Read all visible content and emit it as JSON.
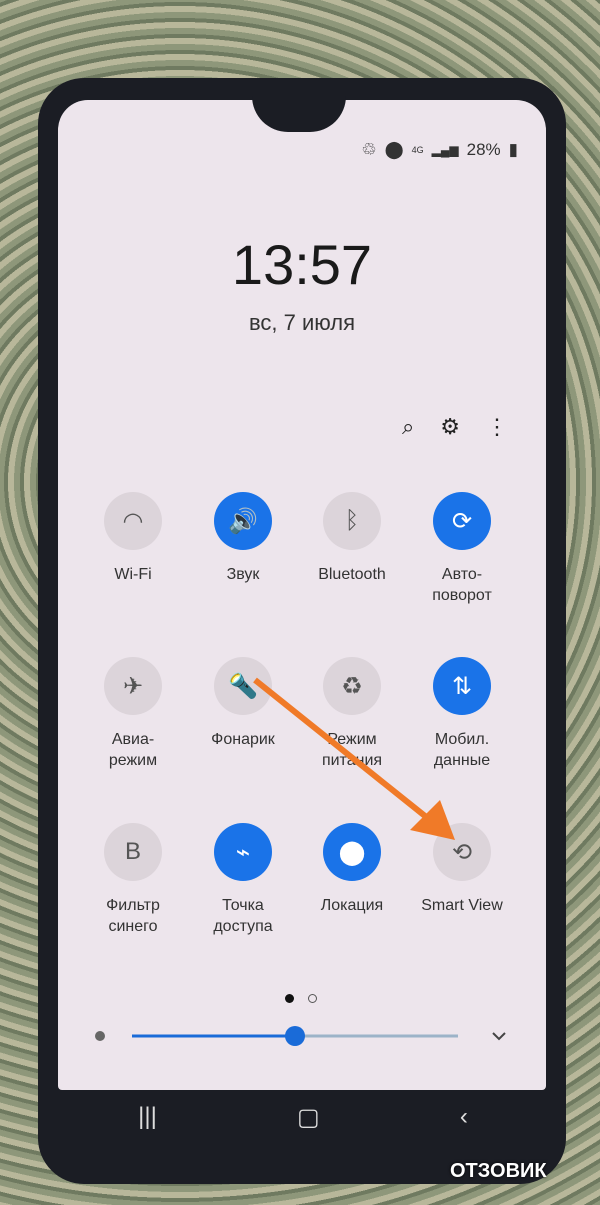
{
  "status_bar": {
    "icons": [
      "recycle-icon",
      "location-icon",
      "4g-icon",
      "signal-icon"
    ],
    "network": "4G",
    "battery": "28%"
  },
  "clock": {
    "time": "13:57",
    "date": "вс, 7 июля"
  },
  "header_icons": [
    "search-icon",
    "gear-icon",
    "more-vert-icon"
  ],
  "tiles": [
    {
      "label": "Wi-Fi",
      "icon": "wifi-icon",
      "on": false
    },
    {
      "label": "Звук",
      "icon": "sound-icon",
      "on": true
    },
    {
      "label": "Bluetooth",
      "icon": "bluetooth-icon",
      "on": false
    },
    {
      "label": "Авто-\nповорот",
      "icon": "auto-rotate-icon",
      "on": true
    },
    {
      "label": "Авиа-\nрежим",
      "icon": "airplane-icon",
      "on": false
    },
    {
      "label": "Фонарик",
      "icon": "flashlight-icon",
      "on": false
    },
    {
      "label": "Режим\nпитания",
      "icon": "power-mode-icon",
      "on": false
    },
    {
      "label": "Мобил.\nданные",
      "icon": "mobile-data-icon",
      "on": true
    },
    {
      "label": "Фильтр\nсинего",
      "icon": "blue-filter-icon",
      "on": false
    },
    {
      "label": "Точка\nдоступа",
      "icon": "hotspot-icon",
      "on": true
    },
    {
      "label": "Локация",
      "icon": "location-icon",
      "on": true
    },
    {
      "label": "Smart View",
      "icon": "smart-view-icon",
      "on": false
    }
  ],
  "pager": {
    "current": 1,
    "total": 2
  },
  "brightness": {
    "level": 0.5
  },
  "colors": {
    "accent": "#1a73e8",
    "arrow": "#f07a28"
  },
  "watermark": "ОТЗОВИК"
}
